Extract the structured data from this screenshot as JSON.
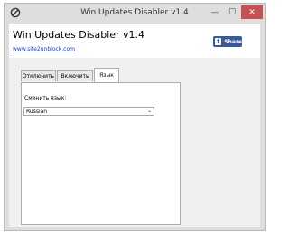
{
  "window": {
    "title": "Win Updates Disabler v1.4",
    "minimize_glyph": "—",
    "maximize_glyph": "☐",
    "close_glyph": "✕"
  },
  "header": {
    "app_title": "Win Updates Disabler v1.4",
    "site_link": "www.site2unblock.com",
    "share_button": {
      "icon": "f",
      "label": "Share"
    }
  },
  "tabs": [
    {
      "label": "Отключить",
      "selected": false
    },
    {
      "label": "Включить",
      "selected": false
    },
    {
      "label": "Язык",
      "selected": true
    }
  ],
  "language_panel": {
    "label": "Сменить язык:",
    "selected_language": "Russian",
    "dropdown_arrow": "⌄"
  },
  "colors": {
    "close_button": "#c75050",
    "facebook_blue": "#3b5998",
    "link_blue": "#1a3fb3"
  }
}
